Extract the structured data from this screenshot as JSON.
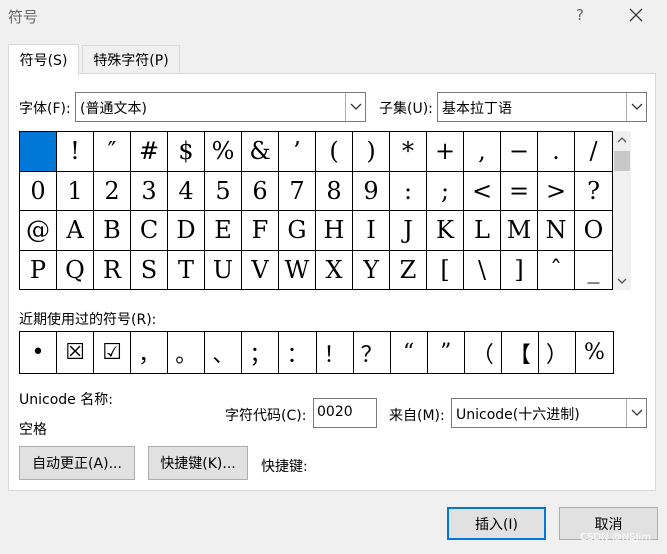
{
  "window": {
    "title": "符号",
    "help_glyph": "?"
  },
  "tabs": [
    {
      "label": "符号(S)"
    },
    {
      "label": "特殊字符(P)"
    }
  ],
  "font": {
    "label": "字体(F):",
    "value": "(普通文本)"
  },
  "subset": {
    "label": "子集(U):",
    "value": "基本拉丁语"
  },
  "symbol_grid": {
    "rows": [
      [
        " ",
        "!",
        "″",
        "#",
        "$",
        "%",
        "&",
        "’",
        "(",
        ")",
        "*",
        "+",
        ",",
        "−",
        ".",
        "/"
      ],
      [
        "0",
        "1",
        "2",
        "3",
        "4",
        "5",
        "6",
        "7",
        "8",
        "9",
        ":",
        ";",
        "<",
        "=",
        ">",
        "?"
      ],
      [
        "@",
        "A",
        "B",
        "C",
        "D",
        "E",
        "F",
        "G",
        "H",
        "I",
        "J",
        "K",
        "L",
        "M",
        "N",
        "O"
      ],
      [
        "P",
        "Q",
        "R",
        "S",
        "T",
        "U",
        "V",
        "W",
        "X",
        "Y",
        "Z",
        "[",
        "\\",
        "]",
        "ˆ",
        "_"
      ]
    ]
  },
  "recent": {
    "label": "近期使用过的符号(R):",
    "symbols": [
      "•",
      "☒",
      "☑",
      "，",
      "。",
      "、",
      "；",
      "：",
      "！",
      "？",
      "“",
      "”",
      "（",
      "【",
      "）",
      "%"
    ]
  },
  "unicode_name": {
    "label": "Unicode 名称:",
    "value": "空格"
  },
  "char_code": {
    "label": "字符代码(C):",
    "value": "0020"
  },
  "from": {
    "label": "来自(M):",
    "value": "Unicode(十六进制)"
  },
  "buttons": {
    "autocorrect": "自动更正(A)...",
    "shortcut_key": "快捷键(K)...",
    "shortcut_label": "快捷键:",
    "insert": "插入(I)",
    "cancel": "取消"
  },
  "watermark": "CSDN @NSJim",
  "colors": {
    "selection": "#0078d7",
    "window_bg": "#f0f0f0"
  }
}
